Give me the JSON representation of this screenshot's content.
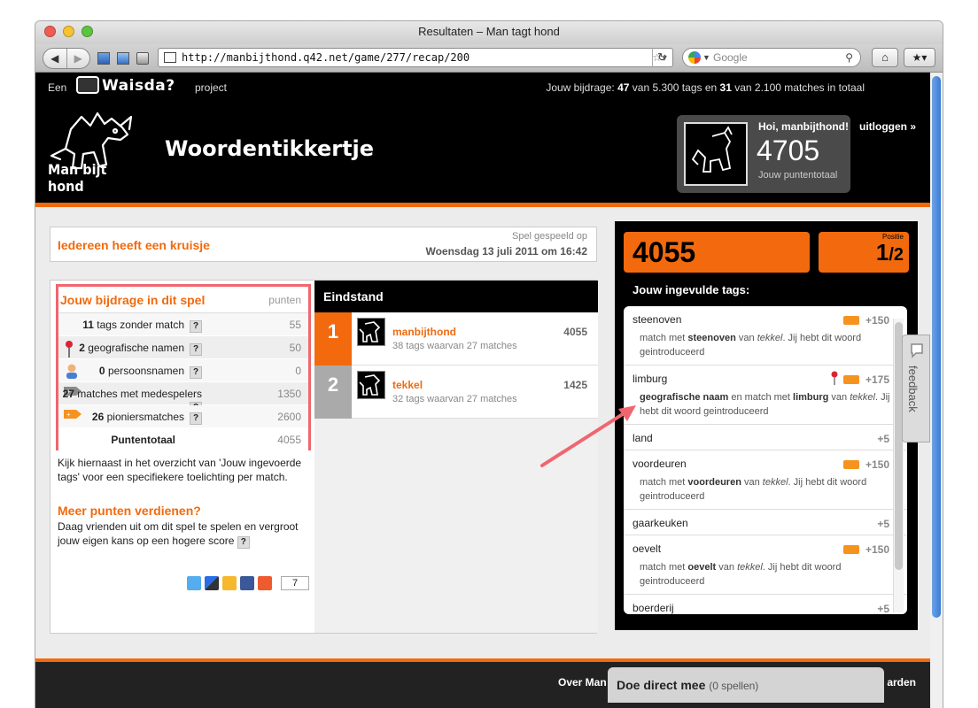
{
  "window": {
    "title": "Resultaten – Man tagt hond"
  },
  "browser": {
    "url": "http://manbijthond.q42.net/game/277/recap/200",
    "search_placeholder": "Google",
    "search_engine_icon": "google-icon"
  },
  "topbar": {
    "prefix": "Een",
    "brand": "Waisda?",
    "suffix": "project",
    "contribution_label": "Jouw bijdrage:",
    "tags_count": "47",
    "tags_of": "van 5.300 tags en",
    "matches_count": "31",
    "matches_of": "van 2.100 matches in totaal"
  },
  "header": {
    "logo_text": "Man bijt hond",
    "game_title": "Woordentikkertje",
    "greeting": "Hoi, manbijthond!",
    "score": "4705",
    "score_label": "Jouw puntentotaal",
    "logout": "uitloggen »"
  },
  "game": {
    "title": "Iedereen heeft een kruisje",
    "played_label": "Spel gespeeld op",
    "date": "Woensdag 13 juli 2011 om 16:42"
  },
  "contribution": {
    "title": "Jouw bijdrage in dit spel",
    "points_header": "punten",
    "rows": [
      {
        "count": "11",
        "label": "tags zonder match",
        "points": "55",
        "icon": ""
      },
      {
        "count": "2",
        "label": "geografische namen",
        "points": "50",
        "icon": "map-pin-icon"
      },
      {
        "count": "0",
        "label": "persoonsnamen",
        "points": "0",
        "icon": "person-icon"
      },
      {
        "count": "27",
        "label": "matches met medespelers",
        "points": "1350",
        "icon": "match-tag-icon"
      },
      {
        "count": "26",
        "label": "pioniersmatches",
        "points": "2600",
        "icon": "pioneer-tag-icon"
      }
    ],
    "total_label": "Puntentotaal",
    "total_points": "4055",
    "help": "?"
  },
  "explanation": "Kijk hiernaast in het overzicht van 'Jouw ingevoerde tags' voor een specifiekere toelichting per match.",
  "more": {
    "title": "Meer punten verdienen?",
    "text": "Daag vrienden uit om dit spel te spelen en vergroot jouw eigen kans op een hogere score",
    "share_count": "7"
  },
  "standings": {
    "title": "Eindstand",
    "players": [
      {
        "rank": "1",
        "name": "manbijthond",
        "sub": "38 tags waarvan 27 matches",
        "score": "4055",
        "color": "#f26a0d"
      },
      {
        "rank": "2",
        "name": "tekkel",
        "sub": "32 tags waarvan 27 matches",
        "score": "1425",
        "color": "#aaaaaa"
      }
    ]
  },
  "right": {
    "score": "4055",
    "position_label": "Positie",
    "position": "1",
    "position_total": "/2",
    "tags_title": "Jouw ingevulde tags:",
    "tags": [
      {
        "name": "steenoven",
        "points": "+150",
        "pin": false,
        "badge": true,
        "desc_pre": "match met",
        "desc_word": "steenoven",
        "desc_mid": "van",
        "desc_user": "tekkel",
        "desc_post": ". Jij hebt dit woord geintroduceerd"
      },
      {
        "name": "limburg",
        "points": "+175",
        "pin": true,
        "badge": true,
        "desc_pre_bold": "geografische naam",
        "desc_pre": "en match met",
        "desc_word": "limburg",
        "desc_mid": "van",
        "desc_user": "tekkel",
        "desc_post": ". Jij hebt dit woord geintroduceerd"
      },
      {
        "name": "land",
        "points": "+5",
        "pin": false,
        "badge": false
      },
      {
        "name": "voordeuren",
        "points": "+150",
        "pin": false,
        "badge": true,
        "desc_pre": "match met",
        "desc_word": "voordeuren",
        "desc_mid": "van",
        "desc_user": "tekkel",
        "desc_post": ". Jij hebt dit woord geintroduceerd"
      },
      {
        "name": "gaarkeuken",
        "points": "+5",
        "pin": false,
        "badge": false
      },
      {
        "name": "oevelt",
        "points": "+150",
        "pin": false,
        "badge": true,
        "desc_pre": "match met",
        "desc_word": "oevelt",
        "desc_mid": "van",
        "desc_user": "tekkel",
        "desc_post": ". Jij hebt dit woord geintroduceerd"
      },
      {
        "name": "boerderij",
        "points": "+5",
        "pin": false,
        "badge": false
      }
    ]
  },
  "feedback": "feedback",
  "footer": {
    "over": "Over Man",
    "right": "arden",
    "direct_title": "Doe direct mee",
    "direct_count": "(0 spellen)"
  },
  "colors": {
    "accent": "#f26a0d",
    "annotation": "#f0666f"
  }
}
